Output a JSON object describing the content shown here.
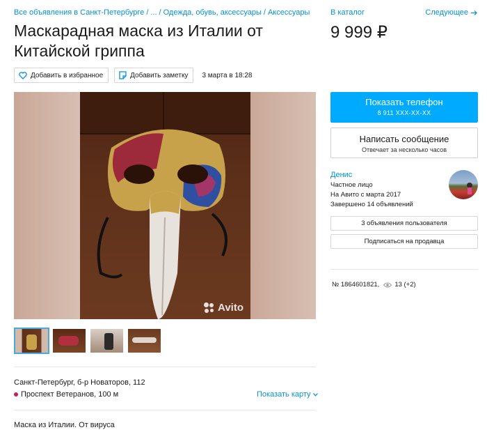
{
  "breadcrumbs": {
    "items": [
      "Все объявления в Санкт-Петербурге",
      "...",
      "Одежда, обувь, аксессуары",
      "Аксессуары"
    ],
    "separator": "/"
  },
  "title": "Маскарадная маска из Италии от Китайской гриппа",
  "actions": {
    "favorite_label": "Добавить в избранное",
    "note_label": "Добавить заметку",
    "date": "3 марта в 18:28"
  },
  "gallery": {
    "watermark": "Avito",
    "thumbnail_count": 4
  },
  "location": {
    "address": "Санкт-Петербург, б-р Новаторов, 112",
    "metro": "Проспект Ветеранов, 100 м",
    "metro_color": "#b8265a",
    "map_link": "Показать карту"
  },
  "description": "Маска из Италии. От вируса",
  "sidebar": {
    "catalog_link": "В каталог",
    "next_link": "Следующее",
    "price": "9 999 ₽",
    "phone_button": {
      "label": "Показать телефон",
      "number": "8 911 XXX-XX-XX",
      "color": "#00aaff"
    },
    "message_button": {
      "label": "Написать сообщение",
      "sublabel": "Отвечает за несколько часов"
    },
    "seller": {
      "name": "Денис",
      "type": "Частное лицо",
      "since": "На Авито с марта 2017",
      "completed": "Завершено 14 объявлений"
    },
    "user_ads_button": "3 объявления пользователя",
    "subscribe_button": "Подписаться на продавца",
    "item_number": "№ 1864601821,",
    "views": "13 (+2)"
  },
  "colors": {
    "link": "#0091d9",
    "text": "#1a1a1a"
  }
}
